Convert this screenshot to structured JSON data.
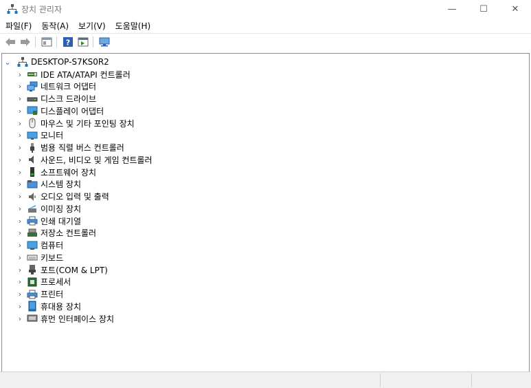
{
  "window": {
    "title": "장치 관리자",
    "controls": {
      "minimize": "—",
      "maximize": "☐",
      "close": "✕"
    }
  },
  "menu": [
    {
      "label": "파일(F)"
    },
    {
      "label": "동작(A)"
    },
    {
      "label": "보기(V)"
    },
    {
      "label": "도움말(H)"
    }
  ],
  "toolbar": {
    "icons": [
      "back-arrow-icon",
      "forward-arrow-icon",
      "properties-icon",
      "help-icon",
      "update-driver-icon",
      "scan-hardware-icon"
    ]
  },
  "tree": {
    "root": {
      "label": "DESKTOP-S7KS0R2",
      "expanded_glyph": "⌄"
    },
    "collapsed_glyph": "›",
    "categories": [
      {
        "label": "IDE ATA/ATAPI 컨트롤러",
        "icon": "ide-controller-icon"
      },
      {
        "label": "네트워크 어댑터",
        "icon": "network-adapter-icon"
      },
      {
        "label": "디스크 드라이브",
        "icon": "disk-drive-icon"
      },
      {
        "label": "디스플레이 어댑터",
        "icon": "display-adapter-icon"
      },
      {
        "label": "마우스 및 기타 포인팅 장치",
        "icon": "mouse-icon"
      },
      {
        "label": "모니터",
        "icon": "monitor-icon"
      },
      {
        "label": "범용 직렬 버스 컨트롤러",
        "icon": "usb-controller-icon"
      },
      {
        "label": "사운드, 비디오 및 게임 컨트롤러",
        "icon": "sound-icon"
      },
      {
        "label": "소프트웨어 장치",
        "icon": "software-device-icon"
      },
      {
        "label": "시스템 장치",
        "icon": "system-device-icon"
      },
      {
        "label": "오디오 입력 및 출력",
        "icon": "audio-io-icon"
      },
      {
        "label": "이미징 장치",
        "icon": "imaging-device-icon"
      },
      {
        "label": "인쇄 대기열",
        "icon": "print-queue-icon"
      },
      {
        "label": "저장소 컨트롤러",
        "icon": "storage-controller-icon"
      },
      {
        "label": "컴퓨터",
        "icon": "computer-icon"
      },
      {
        "label": "키보드",
        "icon": "keyboard-icon"
      },
      {
        "label": "포트(COM & LPT)",
        "icon": "port-icon"
      },
      {
        "label": "프로세서",
        "icon": "processor-icon"
      },
      {
        "label": "프린터",
        "icon": "printer-icon"
      },
      {
        "label": "휴대용 장치",
        "icon": "portable-device-icon"
      },
      {
        "label": "휴먼 인터페이스 장치",
        "icon": "hid-icon"
      }
    ]
  },
  "colors": {
    "accent_blue": "#1e73be",
    "chevron": "#555555",
    "border": "#8a8a8a"
  }
}
